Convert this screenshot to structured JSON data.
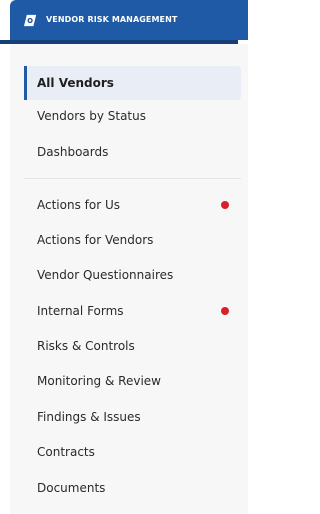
{
  "header": {
    "title": "VENDOR RISK MANAGEMENT",
    "logo_icon": "vendor-logo-icon",
    "background": "#1f5aa6"
  },
  "nav": {
    "primary": [
      {
        "label": "All Vendors",
        "active": true
      },
      {
        "label": "Vendors by Status",
        "active": false
      },
      {
        "label": "Dashboards",
        "active": false
      }
    ],
    "secondary": [
      {
        "label": "Actions for Us",
        "notification": true
      },
      {
        "label": "Actions for Vendors",
        "notification": false
      },
      {
        "label": "Vendor Questionnaires",
        "notification": false
      },
      {
        "label": "Internal Forms",
        "notification": true
      },
      {
        "label": "Risks & Controls",
        "notification": false
      },
      {
        "label": "Monitoring & Review",
        "notification": false
      },
      {
        "label": "Findings & Issues",
        "notification": false
      },
      {
        "label": "Contracts",
        "notification": false
      },
      {
        "label": "Documents",
        "notification": false
      }
    ]
  },
  "colors": {
    "accent": "#1f5aa6",
    "notification_dot": "#d9202a",
    "active_bg": "#e8edf6"
  }
}
